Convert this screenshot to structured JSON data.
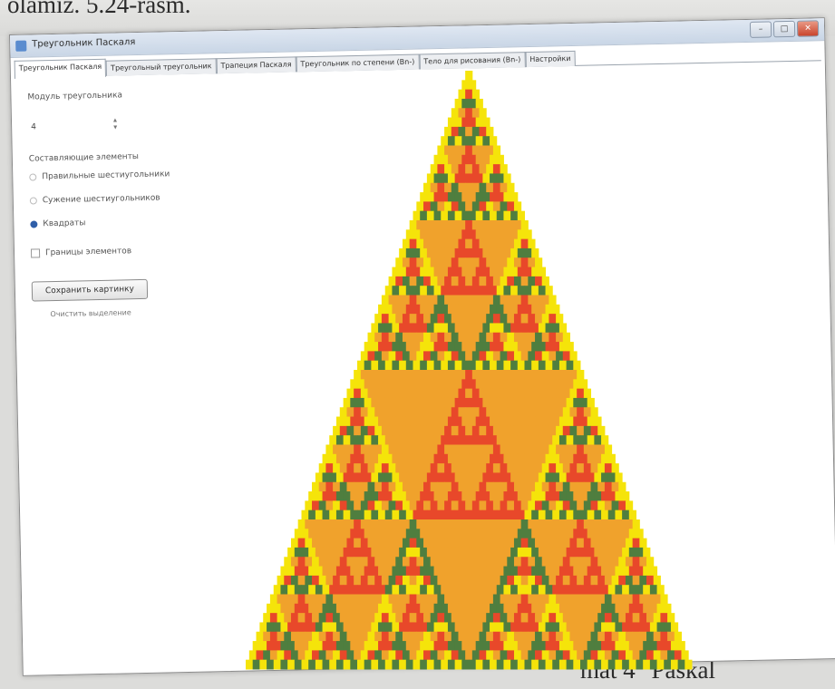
{
  "page": {
    "top_text": "olamiz. 5.24-rasm.",
    "bottom_text": "mat 4 \"Paskal"
  },
  "window": {
    "title": "Треугольник Паскаля",
    "controls": {
      "minimize": "–",
      "maximize": "□",
      "close": "✕"
    }
  },
  "tabs": [
    {
      "label": "Треугольник Паскаля",
      "active": true
    },
    {
      "label": "Треугольный треугольник",
      "active": false
    },
    {
      "label": "Трапеция Паскаля",
      "active": false
    },
    {
      "label": "Треугольник по степени (Bn-)",
      "active": false
    },
    {
      "label": "Тело для рисования (Bn-)",
      "active": false
    },
    {
      "label": "Настройки",
      "active": false
    }
  ],
  "left_panel": {
    "modulus_label": "Модуль треугольника",
    "modulus_value": "4",
    "elements_label": "Составляющие элементы",
    "options": [
      {
        "label": "Правильные шестиугольники",
        "checked": false
      },
      {
        "label": "Сужение шестиугольников",
        "checked": false
      },
      {
        "label": "Квадраты",
        "checked": true
      }
    ],
    "borders_label": "Границы элементов",
    "borders_checked": false,
    "save_button": "Сохранить картинку",
    "clear_link": "Очистить выделение"
  },
  "triangle": {
    "modulus": 4,
    "rows": 64,
    "palette": [
      "#f0a22c",
      "#f5e40a",
      "#e8482a",
      "#4f7e3f"
    ]
  }
}
